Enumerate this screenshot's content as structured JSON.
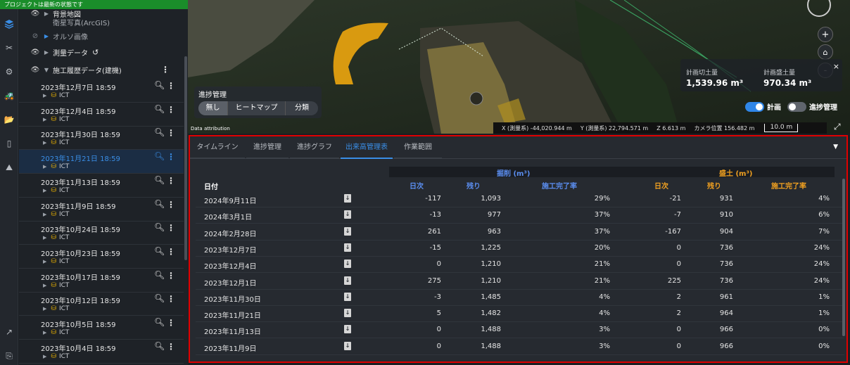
{
  "banner": "プロジェクトは最新の状態です",
  "rail_icons": [
    "layers-icon",
    "tools-icon",
    "settings-icon",
    "vehicle-icon",
    "folder-icon",
    "device-icon",
    "survey-icon",
    "external-link-icon",
    "export-icon"
  ],
  "layers": {
    "top_partial": "背景地図",
    "satellite": "衛星写真(ArcGIS)",
    "ortho": "オルソ画像",
    "survey": "測量データ",
    "construction": "施工履歴データ(建機)",
    "ict_label": "ICT",
    "dates": [
      "2023年12月7日 18:59",
      "2023年12月4日 18:59",
      "2023年11月30日 18:59",
      "2023年11月21日 18:59",
      "2023年11月13日 18:59",
      "2023年11月9日 18:59",
      "2023年10月24日 18:59",
      "2023年10月23日 18:59",
      "2023年10月17日 18:59",
      "2023年10月12日 18:59",
      "2023年10月5日 18:59",
      "2023年10月4日 18:59"
    ],
    "selected_index": 3
  },
  "map": {
    "progress_title": "進捗管理",
    "progress_options": [
      "無し",
      "ヒートマップ",
      "分類"
    ],
    "cut_label": "計画切土量",
    "cut_value": "1,539.96 m³",
    "fill_label": "計画盛土量",
    "fill_value": "970.34 m³",
    "toggle_plan": "計画",
    "toggle_progress": "進捗管理",
    "attribution": "Data attribution",
    "coord_x": "X (測量系) -44,020.944 m",
    "coord_y": "Y (測量系) 22,794.571 m",
    "coord_z": "Z 6.613 m",
    "camera": "カメラ位置 156.482 m",
    "scale": "10.0 m",
    "zoom_in": "+",
    "zoom_out": "-",
    "close": "×"
  },
  "tabs": [
    "タイムライン",
    "進捗管理",
    "進捗グラフ",
    "出来高管理表",
    "作業範囲"
  ],
  "active_tab": 3,
  "table": {
    "date_header": "日付",
    "excavation_title": "掘削 (m³)",
    "fill_title": "盛土 (m³)",
    "sub_headers": [
      "日次",
      "残り",
      "施工完了率"
    ],
    "colors": {
      "excavation": "#5b8ef0",
      "fill": "#f0a020"
    },
    "rows": [
      {
        "date": "2024年9月11日",
        "ex_daily": "-117",
        "ex_remain": "1,093",
        "ex_rate": "29%",
        "fl_daily": "-21",
        "fl_remain": "931",
        "fl_rate": "4%"
      },
      {
        "date": "2024年3月1日",
        "ex_daily": "-13",
        "ex_remain": "977",
        "ex_rate": "37%",
        "fl_daily": "-7",
        "fl_remain": "910",
        "fl_rate": "6%"
      },
      {
        "date": "2024年2月28日",
        "ex_daily": "261",
        "ex_remain": "963",
        "ex_rate": "37%",
        "fl_daily": "-167",
        "fl_remain": "904",
        "fl_rate": "7%"
      },
      {
        "date": "2023年12月7日",
        "ex_daily": "-15",
        "ex_remain": "1,225",
        "ex_rate": "20%",
        "fl_daily": "0",
        "fl_remain": "736",
        "fl_rate": "24%"
      },
      {
        "date": "2023年12月4日",
        "ex_daily": "0",
        "ex_remain": "1,210",
        "ex_rate": "21%",
        "fl_daily": "0",
        "fl_remain": "736",
        "fl_rate": "24%"
      },
      {
        "date": "2023年12月1日",
        "ex_daily": "275",
        "ex_remain": "1,210",
        "ex_rate": "21%",
        "fl_daily": "225",
        "fl_remain": "736",
        "fl_rate": "24%"
      },
      {
        "date": "2023年11月30日",
        "ex_daily": "-3",
        "ex_remain": "1,485",
        "ex_rate": "4%",
        "fl_daily": "2",
        "fl_remain": "961",
        "fl_rate": "1%"
      },
      {
        "date": "2023年11月21日",
        "ex_daily": "5",
        "ex_remain": "1,482",
        "ex_rate": "4%",
        "fl_daily": "2",
        "fl_remain": "964",
        "fl_rate": "1%"
      },
      {
        "date": "2023年11月13日",
        "ex_daily": "0",
        "ex_remain": "1,488",
        "ex_rate": "3%",
        "fl_daily": "0",
        "fl_remain": "966",
        "fl_rate": "0%"
      },
      {
        "date": "2023年11月9日",
        "ex_daily": "0",
        "ex_remain": "1,488",
        "ex_rate": "3%",
        "fl_daily": "0",
        "fl_remain": "966",
        "fl_rate": "0%"
      }
    ]
  }
}
